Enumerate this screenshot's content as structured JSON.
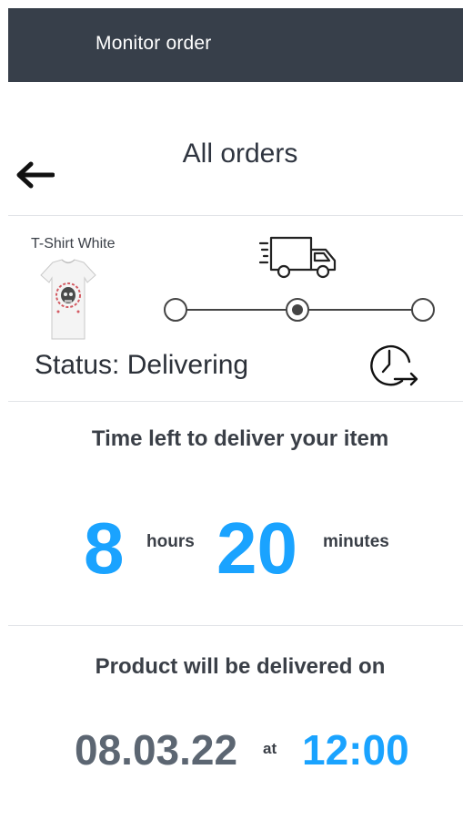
{
  "header": {
    "title": "Monitor order"
  },
  "nav": {
    "back_icon": "arrow-left-icon",
    "page_title": "All orders"
  },
  "order": {
    "product_name": "T-Shirt White",
    "product_image": "t-shirt-with-skull-print",
    "status_text": "Status: Delivering",
    "progress": {
      "steps": 3,
      "current_step": 2
    },
    "truck_icon": "delivery-truck-icon",
    "history_icon": "clock-history-icon"
  },
  "countdown": {
    "label": "Time left to deliver your item",
    "hours_value": "8",
    "hours_unit": "hours",
    "minutes_value": "20",
    "minutes_unit": "minutes"
  },
  "delivery": {
    "label": "Product will be delivered on",
    "date": "08.03.22",
    "at_text": "at",
    "time": "12:00"
  },
  "colors": {
    "header_bg": "#373f4a",
    "accent": "#1aa3ff",
    "date_text": "#5c6672",
    "dark_text": "#2f3540"
  }
}
